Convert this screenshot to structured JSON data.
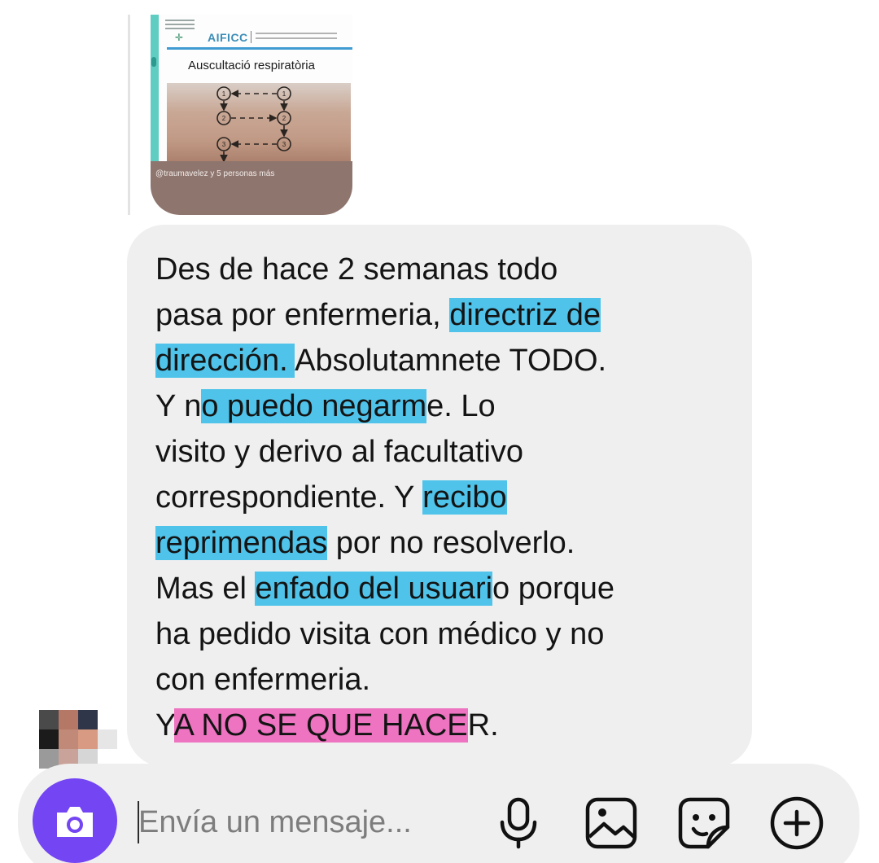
{
  "shared_post": {
    "brand": "AIFICC",
    "slide_title": "Auscultació respiratòria",
    "mentions": "@traumavelez y 5 personas más",
    "diagram_numbers": [
      "1",
      "1",
      "2",
      "2",
      "3",
      "3"
    ]
  },
  "message": {
    "lines": [
      [
        {
          "t": "Des de hace 2 semanas todo"
        }
      ],
      [
        {
          "t": "pasa por enfermeria, "
        },
        {
          "t": "directriz de ",
          "hl": "blue"
        }
      ],
      [
        {
          "t": "dirección. ",
          "hl": "blue"
        },
        {
          "t": "Absolutamnete TODO."
        }
      ],
      [
        {
          "t": "Y n"
        },
        {
          "t": "o puedo negarm",
          "hl": "blue"
        },
        {
          "t": "e. Lo"
        }
      ],
      [
        {
          "t": "visito y derivo al facultativo"
        }
      ],
      [
        {
          "t": "correspondiente. Y "
        },
        {
          "t": "recibo ",
          "hl": "blue"
        }
      ],
      [
        {
          "t": "reprimendas",
          "hl": "blue"
        },
        {
          "t": " por no resolverlo."
        }
      ],
      [
        {
          "t": "Mas el "
        },
        {
          "t": "enfado del usuari",
          "hl": "blue"
        },
        {
          "t": "o porque"
        }
      ],
      [
        {
          "t": "ha pedido visita con médico y no"
        }
      ],
      [
        {
          "t": "con enfermeria."
        }
      ],
      [
        {
          "t": "Y"
        },
        {
          "t": "A NO SE QUE HACE",
          "hl": "pink"
        },
        {
          "t": "R."
        }
      ]
    ]
  },
  "composer": {
    "placeholder": "Envía un mensaje...",
    "icons": [
      "camera-icon",
      "microphone-icon",
      "gallery-icon",
      "sticker-icon",
      "add-icon"
    ]
  },
  "colors": {
    "highlight_blue": "#4fc3ea",
    "highlight_pink": "#ee73c0",
    "camera_button": "#7345f3",
    "bubble": "#efefef"
  }
}
